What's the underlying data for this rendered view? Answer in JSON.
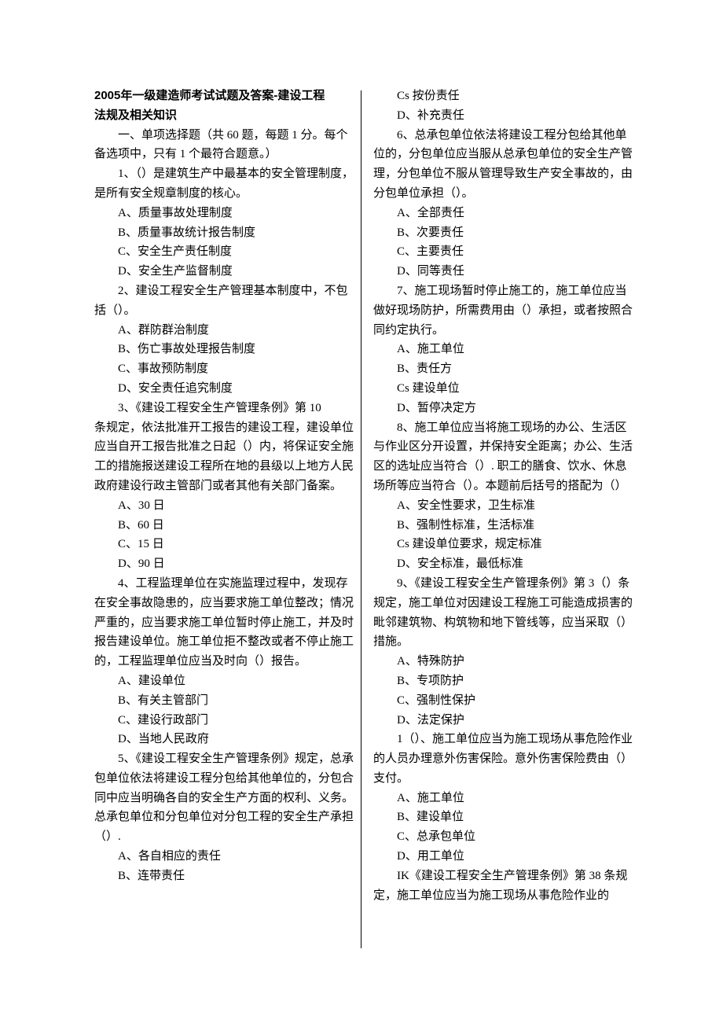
{
  "title_line1": "2005年一级建造师考试试题及答案-建设工程",
  "title_line2": "法规及相关知识",
  "section1_intro": "一、单项选择题（共 60 题，每题 1 分。每个备选项中，只有 1 个最符合题意。）",
  "q1": {
    "text": "1、（）是建筑生产中最基本的安全管理制度，是所有安全规章制度的核心。",
    "A": "A、质量事故处理制度",
    "B": "B、质量事故统计报告制度",
    "C": "C、安全生产责任制度",
    "D": "D、安全生产监督制度"
  },
  "q2": {
    "text": "2、建设工程安全生产管理基本制度中，不包括（）。",
    "A": "A、群防群治制度",
    "B": "B、伤亡事故处理报告制度",
    "C": "C、事故预防制度",
    "D": "D、安全责任追究制度"
  },
  "q3": {
    "text_l1": "3、《建设工程安全生产管理条例》第 10",
    "text_rest": "条规定，依法批准开工报告的建设工程，建设单位应当自开工报告批准之日起（）内，将保证安全施工的措施报送建设工程所在地的县级以上地方人民政府建设行政主管部门或者其他有关部门备案。",
    "A": "A、30 日",
    "B": "B、60 日",
    "C": "C、15 日",
    "D": "D、90 日"
  },
  "q4": {
    "text": "4、工程监理单位在实施监理过程中，发现存在安全事故隐患的，应当要求施工单位整改；情况严重的，应当要求施工单位暂时停止施工，并及时报告建设单位。施工单位拒不整改或者不停止施工的，工程监理单位应当及时向（）报告。",
    "A": "A、建设单位",
    "B": "B、有关主管部门",
    "C": "C、建设行政部门",
    "D": "D、当地人民政府"
  },
  "q5": {
    "text": "5、《建设工程安全生产管理条例》规定，总承包单位依法将建设工程分包给其他单位的，分包合同中应当明确各自的安全生产方面的权利、义务。总承包单位和分包单位对分包工程的安全生产承担（）.",
    "A": "A、各自相应的责任",
    "B": "B、连带责任",
    "C": "Cs 按份责任",
    "D": "D、补充责任"
  },
  "q6": {
    "text": "6、总承包单位依法将建设工程分包给其他单位的，分包单位应当服从总承包单位的安全生产管理，分包单位不服从管理导致生产安全事故的，由分包单位承担（）。",
    "A": "A、全部责任",
    "B": "B、次要责任",
    "C": "C、主要责任",
    "D": "D、同等责任"
  },
  "q7": {
    "text": "7、施工现场暂时停止施工的，施工单位应当做好现场防护，所需费用由（）承担，或者按照合同约定执行。",
    "A": "A、施工单位",
    "B": "B、责任方",
    "C": "Cs 建设单位",
    "D": "D、暂停决定方"
  },
  "q8": {
    "text": "8、施工单位应当将施工现场的办公、生活区与作业区分开设置，并保持安全距离；办公、生活区的选址应当符合（）. 职工的膳食、饮水、休息场所等应当符合（）。本题前后括号的搭配为（）",
    "A": "A、安全性要求，卫生标准",
    "B": "B、强制性标准，生活标准",
    "C": "Cs 建设单位要求，规定标准",
    "D": "D、安全标准，最低标准"
  },
  "q9": {
    "text": "9、《建设工程安全生产管理条例》第 3（）条规定，施工单位对因建设工程施工可能造成损害的毗邻建筑物、构筑物和地下管线等，应当采取（）措施。",
    "A": "A、特殊防护",
    "B": "B、专项防护",
    "C": "C、强制性保护",
    "D": "D、法定保护"
  },
  "q10": {
    "text": "1（）、施工单位应当为施工现场从事危险作业的人员办理意外伤害保险。意外伤害保险费由（）支付。",
    "A": "A、施工单位",
    "B": "B、建设单位",
    "C": "C、总承包单位",
    "D": "D、用工单位"
  },
  "q11": {
    "text": "IK《建设工程安全生产管理条例》第 38 条规定，施工单位应当为施工现场从事危险作业的"
  }
}
